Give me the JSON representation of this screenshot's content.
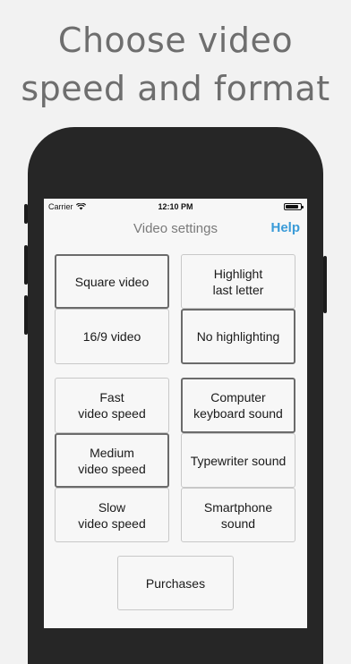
{
  "headline": {
    "line1": "Choose video",
    "line2": "speed and format"
  },
  "status_bar": {
    "carrier": "Carrier",
    "time": "12:10 PM",
    "battery_level": 0.9
  },
  "nav": {
    "title": "Video settings",
    "help": "Help"
  },
  "video_format": [
    {
      "label": "Square video",
      "selected": true
    },
    {
      "label": "16/9 video",
      "selected": false
    }
  ],
  "highlight": [
    {
      "label": "Highlight\nlast letter",
      "selected": false
    },
    {
      "label": "No highlighting",
      "selected": true
    }
  ],
  "speed": [
    {
      "label": "Fast\nvideo speed",
      "selected": false
    },
    {
      "label": "Medium\nvideo speed",
      "selected": true
    },
    {
      "label": "Slow\nvideo speed",
      "selected": false
    }
  ],
  "sound": [
    {
      "label": "Computer\nkeyboard sound",
      "selected": true
    },
    {
      "label": "Typewriter sound",
      "selected": false
    },
    {
      "label": "Smartphone\nsound",
      "selected": false
    }
  ],
  "purchases": {
    "label": "Purchases"
  }
}
